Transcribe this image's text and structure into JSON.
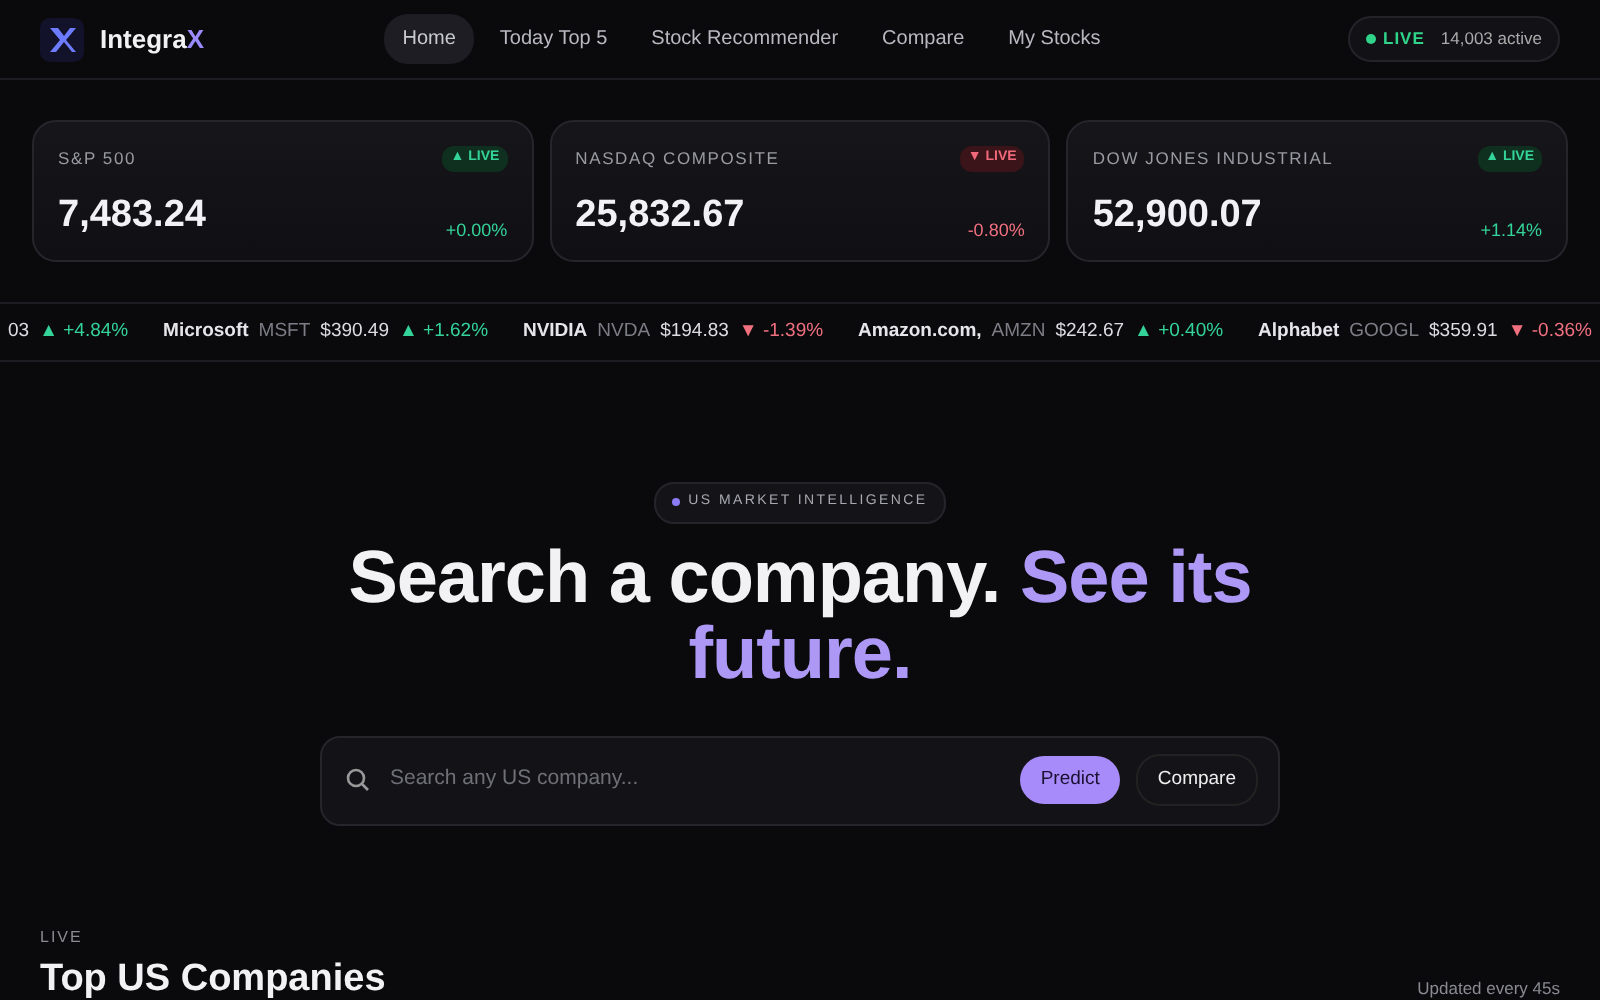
{
  "brand": {
    "name": "Integra",
    "accent": "X"
  },
  "nav": [
    {
      "label": "Home",
      "selected": true
    },
    {
      "label": "Today Top 5",
      "selected": false
    },
    {
      "label": "Stock Recommender",
      "selected": false
    },
    {
      "label": "Compare",
      "selected": false
    },
    {
      "label": "My Stocks",
      "selected": false
    }
  ],
  "status": {
    "label": "LIVE",
    "count": "14,003 active"
  },
  "indices": [
    {
      "name": "S&P 500",
      "badge": "▲ LIVE",
      "positive": true,
      "value": "7,483.24",
      "change": "+0.00%"
    },
    {
      "name": "NASDAQ COMPOSITE",
      "badge": "▼ LIVE",
      "positive": false,
      "value": "25,832.67",
      "change": "-0.80%"
    },
    {
      "name": "DOW JONES INDUSTRIAL",
      "badge": "▲ LIVE",
      "positive": true,
      "value": "52,900.07",
      "change": "+1.14%"
    }
  ],
  "ticker": [
    {
      "price": "03",
      "positive": true,
      "change": "▲ +4.84%"
    },
    {
      "name": "Microsoft",
      "symbol": "MSFT",
      "price": "$390.49",
      "positive": true,
      "change": "▲ +1.62%"
    },
    {
      "name": "NVIDIA",
      "symbol": "NVDA",
      "price": "$194.83",
      "positive": false,
      "change": "▼ -1.39%"
    },
    {
      "name": "Amazon.com,",
      "symbol": "AMZN",
      "price": "$242.67",
      "positive": true,
      "change": "▲ +0.40%"
    },
    {
      "name": "Alphabet",
      "symbol": "GOOGL",
      "price": "$359.91",
      "positive": false,
      "change": "▼ -0.36%"
    }
  ],
  "hero": {
    "eyebrow": "US MARKET INTELLIGENCE",
    "headline": "Search a company.",
    "headline_accent": "See its future."
  },
  "search": {
    "placeholder": "Search any US company...",
    "buttons": [
      {
        "label": "Predict",
        "kind": "primary"
      },
      {
        "label": "Compare",
        "kind": "secondary"
      }
    ]
  },
  "section": {
    "eyebrow": "LIVE",
    "title": "Top US Companies",
    "note": "Updated every 45s"
  }
}
